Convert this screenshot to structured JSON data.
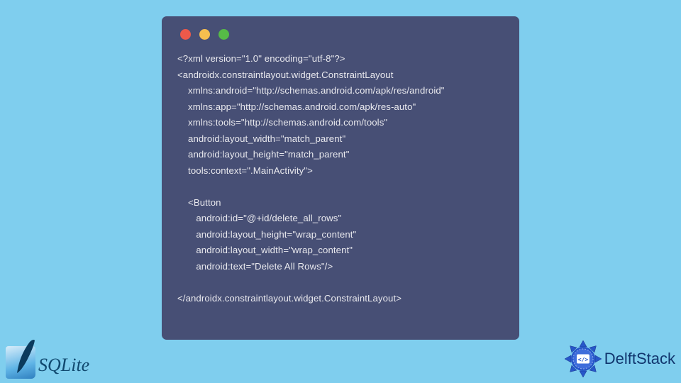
{
  "window": {
    "traffic": {
      "red": "#ed594a",
      "yellow": "#f5be4f",
      "green": "#56ba47"
    }
  },
  "code": {
    "l1": "<?xml version=\"1.0\" encoding=\"utf-8\"?>",
    "l2": "<androidx.constraintlayout.widget.ConstraintLayout",
    "l3": "    xmlns:android=\"http://schemas.android.com/apk/res/android\"",
    "l4": "    xmlns:app=\"http://schemas.android.com/apk/res-auto\"",
    "l5": "    xmlns:tools=\"http://schemas.android.com/tools\"",
    "l6": "    android:layout_width=\"match_parent\"",
    "l7": "    android:layout_height=\"match_parent\"",
    "l8": "    tools:context=\".MainActivity\">",
    "l9": "",
    "l10": "    <Button",
    "l11": "       android:id=\"@+id/delete_all_rows\"",
    "l12": "       android:layout_height=\"wrap_content\"",
    "l13": "       android:layout_width=\"wrap_content\"",
    "l14": "       android:text=\"Delete All Rows\"/>",
    "l15": "",
    "l16": "</androidx.constraintlayout.widget.ConstraintLayout>"
  },
  "logos": {
    "sqlite": "SQLite",
    "delftstack": "DelftStack"
  }
}
